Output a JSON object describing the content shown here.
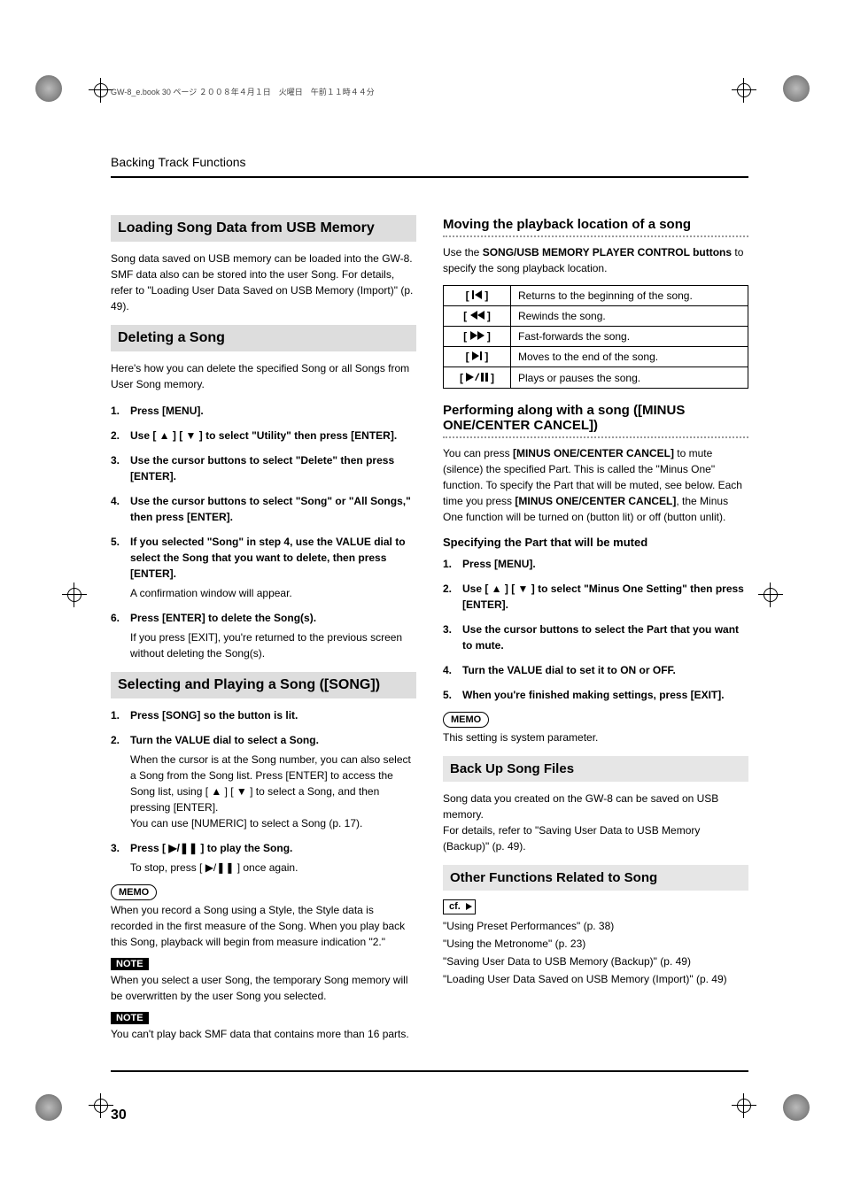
{
  "bookline": "GW-8_e.book 30 ページ ２００８年４月１日　火曜日　午前１１時４４分",
  "running_head": "Backing Track Functions",
  "left": {
    "sec1": {
      "title": "Loading Song Data from USB Memory",
      "para": "Song data saved on USB memory can be loaded into the GW-8. SMF data also can be stored into the user Song. For details, refer to \"Loading User Data Saved on USB Memory (Import)\" (p. 49)."
    },
    "sec2": {
      "title": "Deleting a Song",
      "intro": "Here's how you can delete the specified Song or all Songs from User Song memory.",
      "steps": [
        {
          "n": "1.",
          "main": "Press [MENU]."
        },
        {
          "n": "2.",
          "main": "Use [ ▲ ] [ ▼ ] to select \"Utility\" then press [ENTER]."
        },
        {
          "n": "3.",
          "main": "Use the cursor buttons to select \"Delete\" then press [ENTER]."
        },
        {
          "n": "4.",
          "main": "Use the cursor buttons to select \"Song\" or \"All Songs,\" then press [ENTER]."
        },
        {
          "n": "5.",
          "main": "If you selected \"Song\" in step 4, use the VALUE dial to select the Song that you want to delete, then press [ENTER].",
          "sub": "A confirmation window will appear."
        },
        {
          "n": "6.",
          "main": "Press [ENTER] to delete the Song(s).",
          "sub": "If you press [EXIT], you're returned to the previous screen without deleting the Song(s)."
        }
      ]
    },
    "sec3": {
      "title": "Selecting and Playing a Song ([SONG])",
      "steps": [
        {
          "n": "1.",
          "main": "Press [SONG] so the button is lit."
        },
        {
          "n": "2.",
          "main": "Turn the VALUE dial to select a Song.",
          "sub": "When the cursor is at the Song number, you can also select a Song from the Song list. Press [ENTER] to access the Song list, using [ ▲ ] [ ▼ ] to select a Song, and then pressing [ENTER].\nYou can use [NUMERIC] to select a Song (p. 17)."
        },
        {
          "n": "3.",
          "main": "Press [ ▶/❚❚ ] to play the Song.",
          "sub": "To stop, press [ ▶/❚❚ ] once again."
        }
      ],
      "memo_label": "MEMO",
      "memo": "When you record a Song using a Style, the Style data is recorded in the first measure of the Song. When you play back this Song, playback will begin from measure indication \"2.\"",
      "note1_label": "NOTE",
      "note1": "When you select a user Song, the temporary Song memory will be overwritten by the user Song you selected.",
      "note2_label": "NOTE",
      "note2": "You can't play back SMF data that contains more than 16 parts."
    }
  },
  "right": {
    "sub1": {
      "title": "Moving the playback location of a song",
      "intro_a": "Use the ",
      "intro_bold": "SONG/USB MEMORY PLAYER CONTROL buttons",
      "intro_b": " to specify the song playback location.",
      "rows": [
        {
          "icon": "skip-start",
          "desc": "Returns to the beginning of the song."
        },
        {
          "icon": "rew",
          "desc": "Rewinds the song."
        },
        {
          "icon": "ffw",
          "desc": "Fast-forwards the song."
        },
        {
          "icon": "skip-end",
          "desc": "Moves to the end of the song."
        },
        {
          "icon": "play-pause",
          "desc": "Plays or pauses the song."
        }
      ]
    },
    "sub2": {
      "title": "Performing along with a song ([MINUS ONE/CENTER CANCEL])",
      "para1_a": "You can press ",
      "para1_bold1": "[MINUS ONE/CENTER CANCEL]",
      "para1_b": " to mute (silence) the specified Part. This is called the \"Minus One\" function. To specify the Part that will be muted, see below. Each time you press ",
      "para1_bold2": "[MINUS ONE/CENTER CANCEL]",
      "para1_c": ", the Minus One function will be turned on (button lit) or off (button unlit).",
      "subhead": "Specifying the Part that will be muted",
      "steps": [
        {
          "n": "1.",
          "main": "Press [MENU]."
        },
        {
          "n": "2.",
          "main": "Use [ ▲ ] [ ▼ ] to select \"Minus One Setting\" then press [ENTER]."
        },
        {
          "n": "3.",
          "main": "Use the cursor buttons to select the Part that you want to mute."
        },
        {
          "n": "4.",
          "main": "Turn the VALUE dial to set it to ON or OFF."
        },
        {
          "n": "5.",
          "main": "When you're finished making settings, press [EXIT]."
        }
      ],
      "memo_label": "MEMO",
      "memo": "This setting is system parameter."
    },
    "sec_backup": {
      "title": "Back Up Song Files",
      "para": "Song data you created on the GW-8 can be saved on USB memory.\nFor details, refer to \"Saving User Data to USB Memory (Backup)\" (p. 49)."
    },
    "sec_other": {
      "title": "Other Functions Related to Song",
      "cf_label": "cf.",
      "refs": [
        "\"Using Preset Performances\" (p. 38)",
        "\"Using the Metronome\" (p. 23)",
        "\"Saving User Data to USB Memory (Backup)\" (p. 49)",
        "\"Loading User Data Saved on USB Memory (Import)\" (p. 49)"
      ]
    }
  },
  "page_number": "30"
}
